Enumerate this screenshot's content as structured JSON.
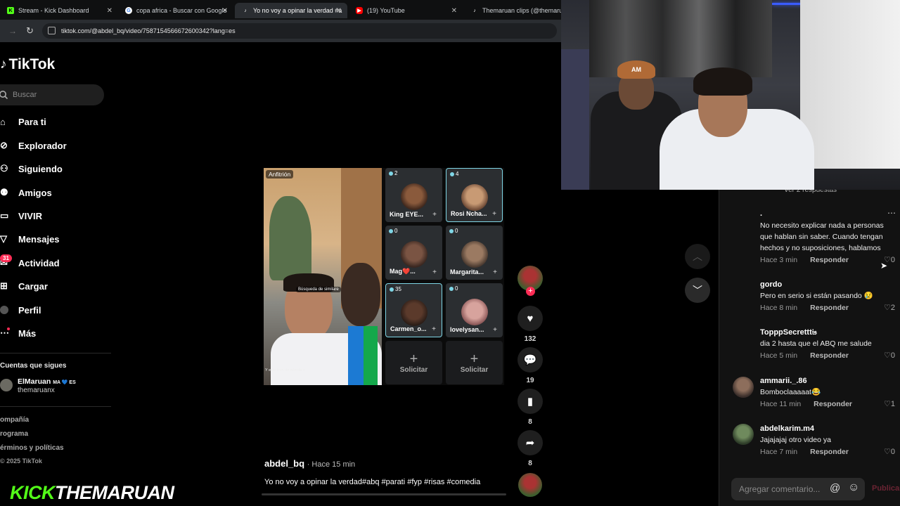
{
  "browser": {
    "tabs": [
      {
        "label": "Stream - Kick Dashboard",
        "icon": "kick-icon"
      },
      {
        "label": "copa africa - Buscar con Google",
        "icon": "google-icon"
      },
      {
        "label": "Yo no voy a opinar la verdad #a",
        "icon": "tiktok-icon",
        "active": true
      },
      {
        "label": "(19) YouTube",
        "icon": "youtube-icon"
      },
      {
        "label": "Themaruan clips (@themaruan",
        "icon": "tiktok-icon"
      }
    ],
    "url": "tiktok.com/@abdel_bq/video/7587154566672600342?lang=es"
  },
  "sidebar": {
    "logo": "TikTok",
    "search_placeholder": "Buscar",
    "nav": [
      {
        "label": "Para ti",
        "icon": "home-icon"
      },
      {
        "label": "Explorador",
        "icon": "compass-icon"
      },
      {
        "label": "Siguiendo",
        "icon": "following-icon"
      },
      {
        "label": "Amigos",
        "icon": "friends-icon"
      },
      {
        "label": "VIVIR",
        "icon": "live-icon"
      },
      {
        "label": "Mensajes",
        "icon": "message-icon"
      },
      {
        "label": "Actividad",
        "icon": "activity-icon",
        "badge": "31"
      },
      {
        "label": "Cargar",
        "icon": "upload-icon"
      },
      {
        "label": "Perfil",
        "icon": "profile-icon"
      },
      {
        "label": "Más",
        "icon": "more-icon"
      }
    ],
    "following_title": "Cuentas que sigues",
    "following": {
      "name": "ElMaruan",
      "suffix": "MA 💙 ES",
      "handle": "themaruanx"
    },
    "footer": [
      "ompañía",
      "rograma",
      "érminos y políticas",
      "© 2025 TikTok"
    ]
  },
  "video": {
    "host_label": "Anfitrión",
    "host_caption": "Búsqueda de similare",
    "bottom_caption": "Y este tren de mierda e",
    "participants": [
      {
        "count": "2",
        "name": "King EYE..."
      },
      {
        "count": "4",
        "name": "Rosi Ncha..."
      },
      {
        "count": "0",
        "name": "Mag❤️..."
      },
      {
        "count": "0",
        "name": "Margarita..."
      },
      {
        "count": "35",
        "name": "Carmen_o..."
      },
      {
        "count": "0",
        "name": "lovelysan..."
      }
    ],
    "request_label": "Solicitar",
    "author": "abdel_bq",
    "time": "· Hace 15 min",
    "description": "Yo no voy a opinar la verdad#abq #parati #fyp #risas #comedia"
  },
  "actions": {
    "likes": "132",
    "comments": "19",
    "saves": "8",
    "shares": "8"
  },
  "comments": {
    "replies_toggle": "Ver 2 respuestas",
    "items": [
      {
        "user": ".",
        "text": "No necesito explicar nada a personas que hablan sin saber. Cuando tengan hechos y no suposiciones, hablamos",
        "time": "Hace 3 min",
        "reply": "Responder",
        "likes": "0"
      },
      {
        "user": "gordo",
        "text": "Pero en serio si están pasando 😢",
        "time": "Hace 8 min",
        "reply": "Responder",
        "likes": "2"
      },
      {
        "user": "TopppSecrettt𝔦𝔰",
        "text": "dia 2 hasta que el ABQ me salude",
        "time": "Hace 5 min",
        "reply": "Responder",
        "likes": "0"
      },
      {
        "user": "ammarii._.86",
        "text": "Bomboclaaaaat😂",
        "time": "Hace 11 min",
        "reply": "Responder",
        "likes": "1"
      },
      {
        "user": "abdelkarim.m4",
        "text": "Jajajajaj otro video ya",
        "time": "Hace 7 min",
        "reply": "Responder",
        "likes": "0"
      }
    ],
    "input_placeholder": "Agregar comentario...",
    "post_label": "Publicar"
  },
  "overlay": {
    "kick_part": "KICK",
    "channel_part": "THEMARUAN",
    "cap_logo": "AM"
  },
  "colors": {
    "kick_green": "#53fc18",
    "tiktok_red": "#fe2c55",
    "active_border": "#7fd6e6"
  }
}
